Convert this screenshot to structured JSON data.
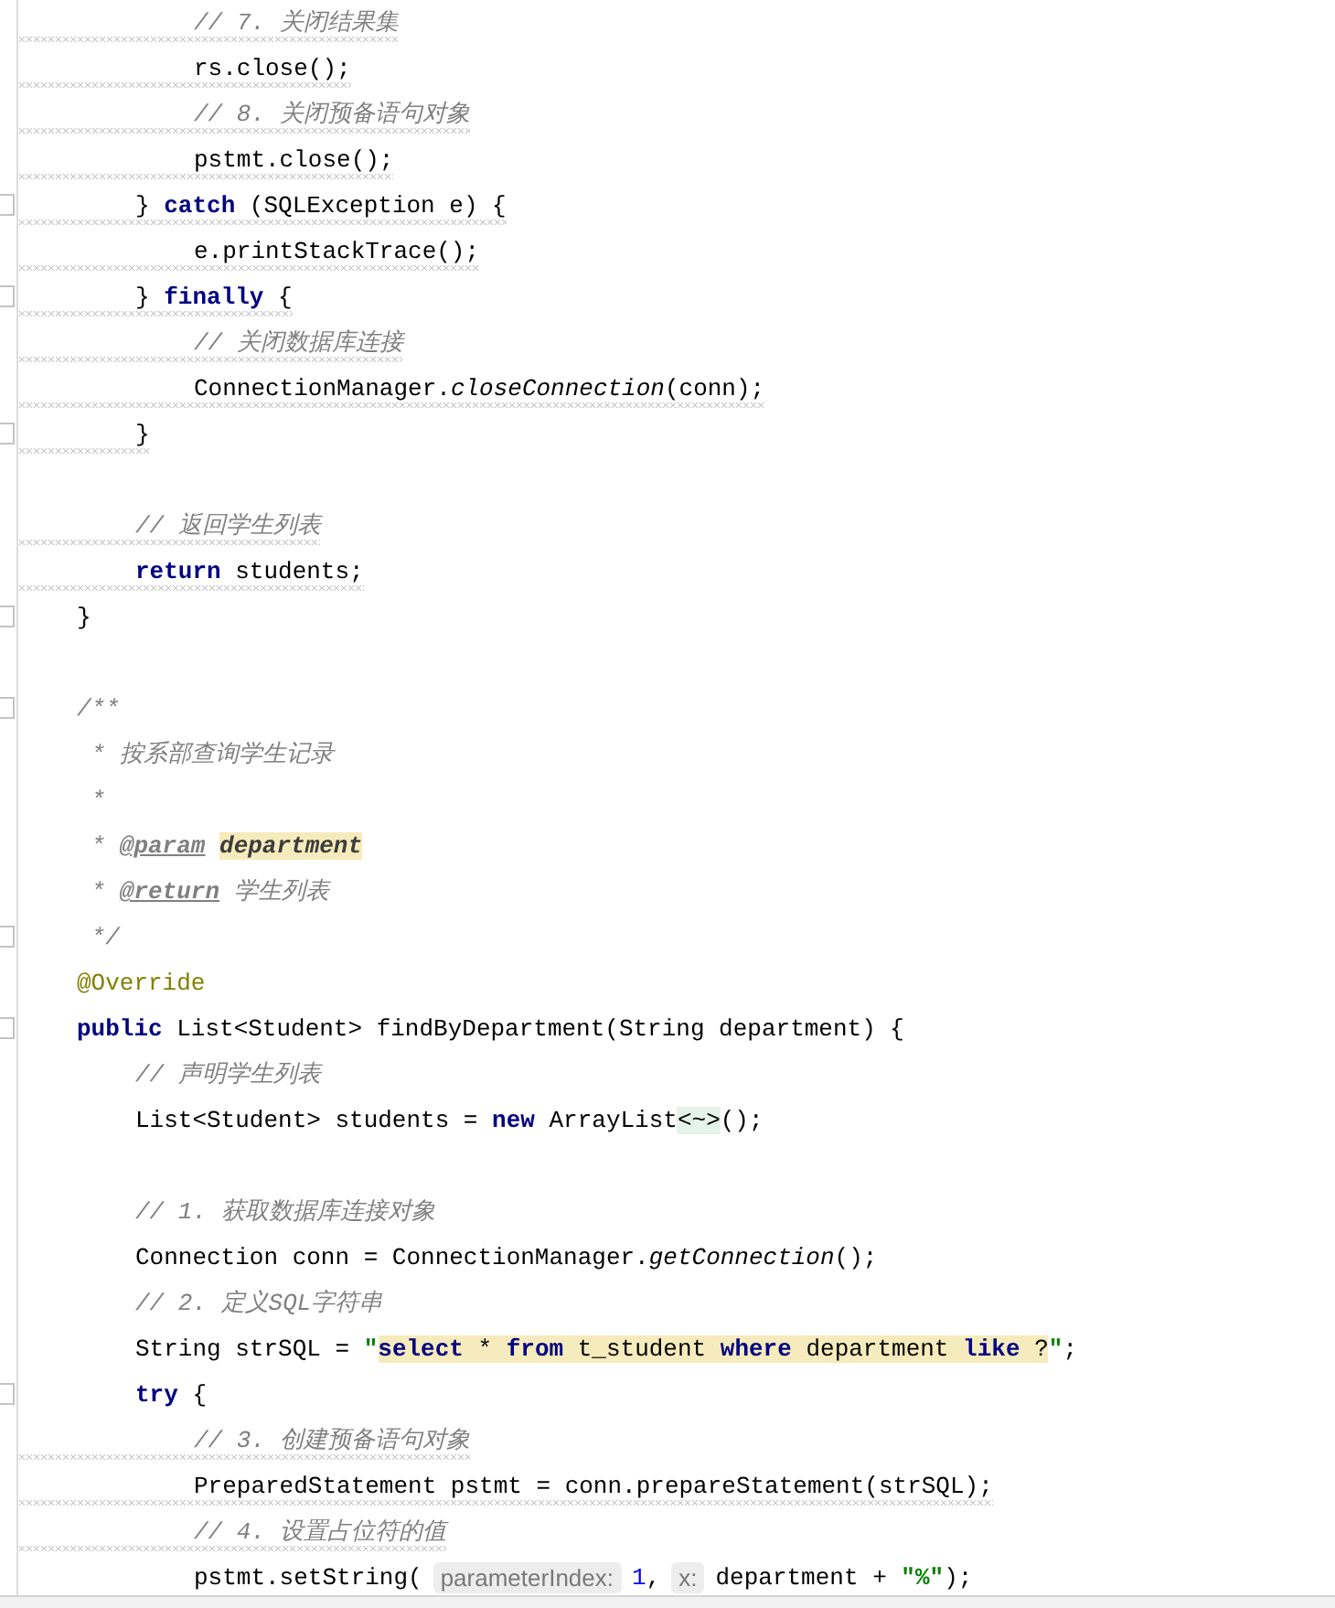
{
  "editor": {
    "lines": [
      {
        "kind": "group",
        "children": [
          {
            "kind": "group",
            "children": [
              {
                "kind": "code",
                "squiggle": true,
                "tokens": [
                  {
                    "kind": "comment",
                    "text": "// 7. 关闭结果集"
                  }
                ]
              },
              {
                "kind": "code",
                "squiggle": true,
                "tokens": [
                  {
                    "kind": "plain",
                    "text": "rs.close();"
                  }
                ]
              },
              {
                "kind": "code",
                "squiggle": true,
                "tokens": [
                  {
                    "kind": "comment",
                    "text": "// 8. 关闭预备语句对象"
                  }
                ]
              },
              {
                "kind": "code",
                "squiggle": true,
                "tokens": [
                  {
                    "kind": "plain",
                    "text": "pstmt.close();"
                  }
                ]
              }
            ]
          },
          {
            "kind": "code",
            "squiggle": true,
            "fold": true,
            "tokens": [
              {
                "kind": "plain",
                "text": "} "
              },
              {
                "kind": "keyword",
                "text": "catch"
              },
              {
                "kind": "plain",
                "text": " (SQLException e) {"
              }
            ],
            "children": [
              {
                "kind": "code",
                "squiggle": true,
                "tokens": [
                  {
                    "kind": "plain",
                    "text": "e.printStackTrace();"
                  }
                ]
              }
            ]
          },
          {
            "kind": "code",
            "squiggle": true,
            "fold": true,
            "tokens": [
              {
                "kind": "plain",
                "text": "} "
              },
              {
                "kind": "keyword",
                "text": "finally"
              },
              {
                "kind": "plain",
                "text": " {"
              }
            ],
            "children": [
              {
                "kind": "code",
                "squiggle": true,
                "tokens": [
                  {
                    "kind": "comment",
                    "text": "// 关闭数据库连接"
                  }
                ]
              },
              {
                "kind": "code",
                "squiggle": true,
                "tokens": [
                  {
                    "kind": "plain",
                    "text": "ConnectionManager."
                  },
                  {
                    "kind": "static",
                    "text": "closeConnection"
                  },
                  {
                    "kind": "plain",
                    "text": "(conn);"
                  }
                ]
              }
            ]
          },
          {
            "kind": "code",
            "squiggle": true,
            "fold": true,
            "tokens": [
              {
                "kind": "plain",
                "text": "}"
              }
            ]
          },
          {
            "kind": "blank"
          },
          {
            "kind": "code",
            "squiggle": true,
            "tokens": [
              {
                "kind": "comment",
                "text": "// 返回学生列表"
              }
            ]
          },
          {
            "kind": "code",
            "squiggle": true,
            "tokens": [
              {
                "kind": "keyword",
                "text": "return"
              },
              {
                "kind": "plain",
                "text": " students;"
              }
            ]
          }
        ]
      },
      {
        "kind": "code",
        "squiggle": false,
        "fold": true,
        "tokens": [
          {
            "kind": "plain",
            "text": "}"
          }
        ]
      },
      {
        "kind": "blank"
      },
      {
        "kind": "code",
        "squiggle": false,
        "fold": true,
        "tokens": [
          {
            "kind": "comment",
            "text": "/**"
          }
        ]
      },
      {
        "kind": "code",
        "squiggle": false,
        "fold": false,
        "tokens": [
          {
            "kind": "comment",
            "text": " * 按系部查询学生记录"
          }
        ]
      },
      {
        "kind": "code",
        "squiggle": false,
        "fold": false,
        "tokens": [
          {
            "kind": "comment",
            "text": " *"
          }
        ]
      },
      {
        "kind": "code",
        "squiggle": false,
        "fold": false,
        "tokens": [
          {
            "kind": "comment",
            "text": " * "
          },
          {
            "kind": "doctag",
            "text": "@param"
          },
          {
            "kind": "docparam",
            "text": "department",
            "highlighted": true
          }
        ]
      },
      {
        "kind": "code",
        "squiggle": false,
        "fold": false,
        "tokens": [
          {
            "kind": "comment",
            "text": " * "
          },
          {
            "kind": "doctag",
            "text": "@return"
          },
          {
            "kind": "comment",
            "text": " 学生列表"
          }
        ]
      },
      {
        "kind": "code",
        "squiggle": false,
        "fold": true,
        "tokens": [
          {
            "kind": "comment",
            "text": " */"
          }
        ]
      },
      {
        "kind": "code",
        "squiggle": false,
        "fold": false,
        "tokens": [
          {
            "kind": "annotation",
            "text": "@Override"
          }
        ]
      },
      {
        "kind": "code",
        "squiggle": false,
        "fold": true,
        "tokens": [
          {
            "kind": "keyword",
            "text": "public"
          },
          {
            "kind": "plain",
            "text": " List<Student> findByDepartment(String department) {"
          }
        ],
        "children": [
          {
            "kind": "code",
            "squiggle": false,
            "fold": false,
            "tokens": [
              {
                "kind": "comment",
                "text": "// 声明学生列表"
              }
            ]
          },
          {
            "kind": "code",
            "squiggle": false,
            "fold": false,
            "tokens": [
              {
                "kind": "plain",
                "text": "List<Student> students = "
              },
              {
                "kind": "keyword",
                "text": "new"
              },
              {
                "kind": "plain",
                "text": " ArrayList"
              },
              {
                "kind": "diamond",
                "text": "<~>"
              },
              {
                "kind": "plain",
                "text": "();"
              }
            ]
          },
          {
            "kind": "blank"
          },
          {
            "kind": "code",
            "squiggle": false,
            "fold": false,
            "tokens": [
              {
                "kind": "comment",
                "text": "// 1. 获取数据库连接对象"
              }
            ]
          },
          {
            "kind": "code",
            "squiggle": false,
            "fold": false,
            "tokens": [
              {
                "kind": "plain",
                "text": "Connection conn = ConnectionManager."
              },
              {
                "kind": "static",
                "text": "getConnection"
              },
              {
                "kind": "plain",
                "text": "();"
              }
            ]
          },
          {
            "kind": "code",
            "squiggle": false,
            "fold": false,
            "tokens": [
              {
                "kind": "comment",
                "text": "// 2. 定义SQL字符串"
              }
            ]
          },
          {
            "kind": "code",
            "squiggle": false,
            "fold": false,
            "tokens": [
              {
                "kind": "plain",
                "text": "String strSQL = "
              },
              {
                "kind": "string",
                "text": "\""
              },
              {
                "kind": "keyword",
                "text": "select",
                "highlighted": true
              },
              {
                "kind": "plain",
                "text": " * ",
                "highlighted": true
              },
              {
                "kind": "keyword",
                "text": "from",
                "highlighted": true
              },
              {
                "kind": "plain",
                "text": " t_student ",
                "highlighted": true
              },
              {
                "kind": "keyword",
                "text": "where",
                "highlighted": true
              },
              {
                "kind": "plain",
                "text": " department ",
                "highlighted": true
              },
              {
                "kind": "keyword",
                "text": "like",
                "highlighted": true
              },
              {
                "kind": "plain",
                "text": " ?",
                "highlighted": true
              },
              {
                "kind": "string",
                "text": "\""
              },
              {
                "kind": "plain",
                "text": ";"
              }
            ]
          },
          {
            "kind": "code",
            "squiggle": false,
            "fold": true,
            "tokens": [
              {
                "kind": "keyword",
                "text": "try"
              },
              {
                "kind": "plain",
                "text": " {"
              }
            ],
            "children": [
              {
                "kind": "code",
                "squiggle": true,
                "fold": false,
                "tokens": [
                  {
                    "kind": "comment",
                    "text": "// 3. 创建预备语句对象"
                  }
                ]
              },
              {
                "kind": "code",
                "squiggle": true,
                "fold": false,
                "tokens": [
                  {
                    "kind": "plain",
                    "text": "PreparedStatement pstmt = conn.prepareStatement(strSQL);"
                  }
                ]
              },
              {
                "kind": "code",
                "squiggle": true,
                "fold": false,
                "tokens": [
                  {
                    "kind": "comment",
                    "text": "// 4. 设置占位符的值"
                  }
                ]
              },
              {
                "kind": "code",
                "squiggle": false,
                "fold": false,
                "tokens": [
                  {
                    "kind": "plain",
                    "text": "pstmt.setString("
                  },
                  {
                    "kind": "hint",
                    "text": "parameterIndex:"
                  },
                  {
                    "kind": "number",
                    "text": "1"
                  },
                  {
                    "kind": "plain",
                    "text": ","
                  },
                  {
                    "kind": "hint",
                    "text": "x:"
                  },
                  {
                    "kind": "plain",
                    "text": "department + "
                  },
                  {
                    "kind": "string",
                    "text": "\"%\""
                  },
                  {
                    "kind": "plain",
                    "text": ");"
                  }
                ]
              }
            ]
          }
        ]
      }
    ]
  }
}
